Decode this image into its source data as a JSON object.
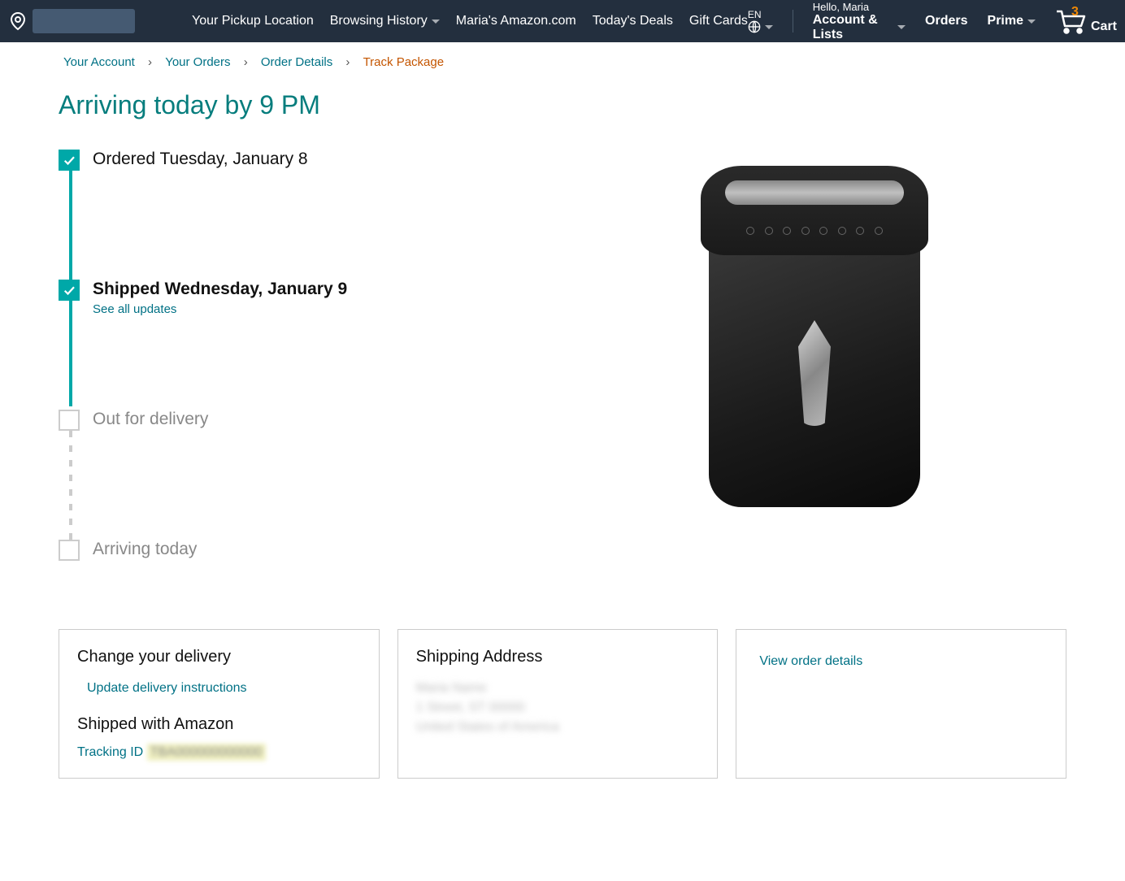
{
  "nav": {
    "pickup": "Your Pickup Location",
    "browsing": "Browsing History",
    "store": "Maria's Amazon.com",
    "deals": "Today's Deals",
    "gift": "Gift Cards",
    "lang": "EN",
    "hello": "Hello, Maria",
    "account": "Account & Lists",
    "orders": "Orders",
    "prime": "Prime",
    "cart_count": "3",
    "cart_label": "Cart"
  },
  "breadcrumb": {
    "account": "Your Account",
    "orders": "Your Orders",
    "details": "Order Details",
    "current": "Track Package"
  },
  "headline": "Arriving today by 9 PM",
  "timeline": {
    "ordered": "Ordered Tuesday, January 8",
    "shipped": "Shipped Wednesday, January 9",
    "see_all": "See all updates",
    "out": "Out for delivery",
    "arriving": "Arriving today"
  },
  "cards": {
    "change_title": "Change your delivery",
    "update_link": "Update delivery instructions",
    "shipped_with": "Shipped with Amazon",
    "tracking_label": "Tracking ID",
    "tracking_value": "TBA000000000000",
    "shipping_title": "Shipping Address",
    "addr1": "Maria Name",
    "addr2": "1 Street, ST 00000",
    "addr3": "United States of America",
    "view_details": "View order details"
  }
}
